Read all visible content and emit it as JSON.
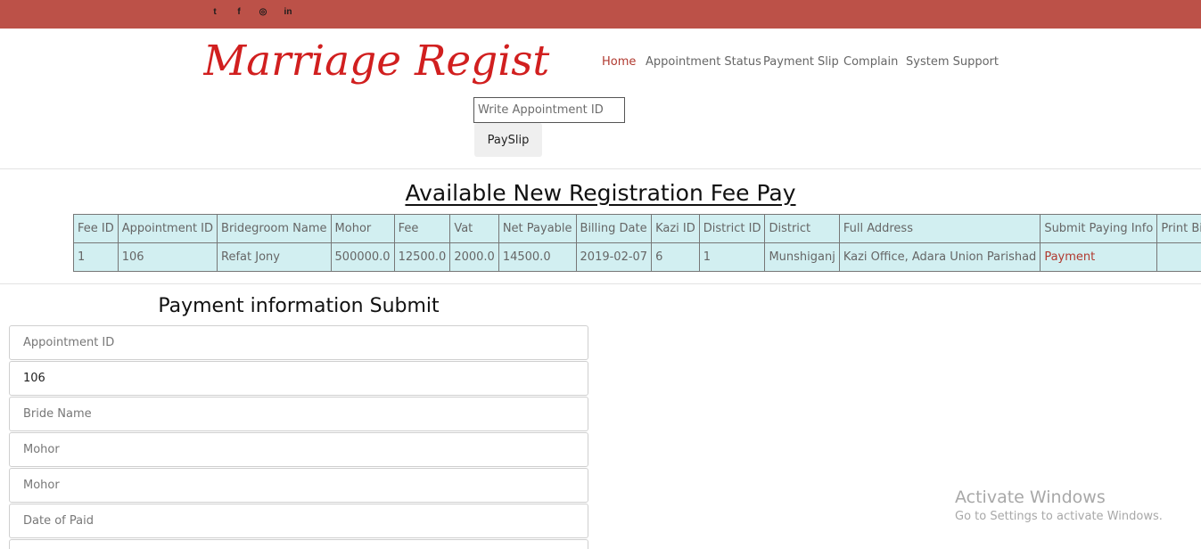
{
  "social": {
    "twitter": "t",
    "facebook": "f",
    "instagram": "◎",
    "linkedin": "in"
  },
  "brand": {
    "logo_text": "Marriage Register",
    "color": "#d11f1f"
  },
  "nav": {
    "home": "Home",
    "appointment_status": "Appointment Status",
    "payment_slip": "Payment Slip",
    "complain": "Complain",
    "system_support": "System Support"
  },
  "slip": {
    "placeholder": "Write Appointment ID",
    "button": "PaySlip"
  },
  "fee_section": {
    "title": "Available New Registration Fee Pay",
    "headers": {
      "fee_id": "Fee ID",
      "appointment_id": "Appointment ID",
      "bridegroom_name": "Bridegroom Name",
      "mohor": "Mohor",
      "fee": "Fee",
      "vat": "Vat",
      "net_payable": "Net Payable",
      "billing_date": "Billing Date",
      "kazi_id": "Kazi ID",
      "district_id": "District ID",
      "district": "District",
      "full_address": "Full Address",
      "submit_paying_info": "Submit Paying Info",
      "print_bill": "Print Bill"
    },
    "rows": [
      {
        "fee_id": "1",
        "appointment_id": "106",
        "bridegroom_name": "Refat Jony",
        "mohor": "500000.0",
        "fee": "12500.0",
        "vat": "2000.0",
        "net_payable": "14500.0",
        "billing_date": "2019-02-07",
        "kazi_id": "6",
        "district_id": "1",
        "district": "Munshiganj",
        "full_address": "Kazi Office, Adara Union Parishad",
        "submit_paying_info": "Payment",
        "print_bill": ""
      }
    ]
  },
  "payment_form": {
    "title": "Payment information Submit",
    "appointment_id_placeholder": "Appointment ID",
    "appointment_id_value": "106",
    "bride_name_placeholder": "Bride Name",
    "mohor_placeholder_1": "Mohor",
    "mohor_placeholder_2": "Mohor",
    "date_paid_placeholder": "Date of Paid"
  },
  "watermark": {
    "line1": "Activate Windows",
    "line2": "Go to Settings to activate Windows."
  }
}
